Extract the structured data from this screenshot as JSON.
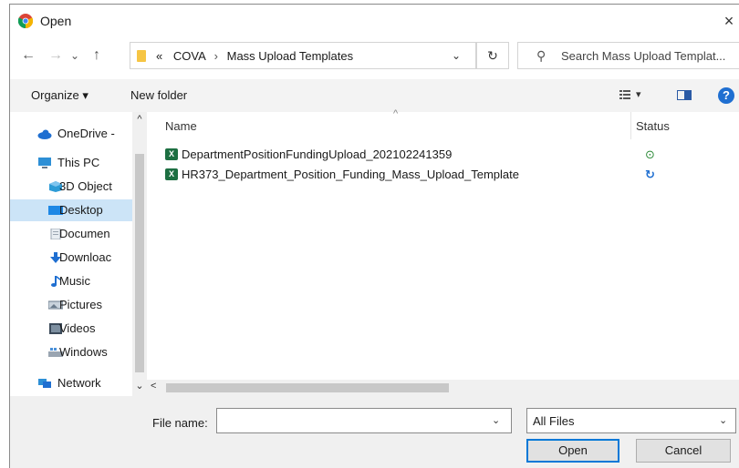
{
  "window": {
    "title": "Open",
    "close_glyph": "×"
  },
  "nav": {
    "back_glyph": "←",
    "forward_glyph": "→",
    "recent_glyph": "⌄",
    "up_glyph": "↑",
    "breadcrumb_prefix": "«",
    "breadcrumb": [
      "COVA",
      "Mass Upload Templates"
    ],
    "breadcrumb_sep": "›",
    "dropdown_glyph": "⌄",
    "refresh_glyph": "↻"
  },
  "search": {
    "placeholder": "Search Mass Upload Templat..."
  },
  "toolbar": {
    "organize_label": "Organize ▾",
    "new_folder_label": "New folder",
    "view_caret": "▾",
    "help_glyph": "?"
  },
  "sidebar": {
    "items": [
      {
        "label": "OneDrive -",
        "icon": "cloud-icon",
        "color": "#1f6fd1"
      },
      {
        "label": "This PC",
        "icon": "computer-icon",
        "color": "#2d8fd6"
      },
      {
        "label": "3D Object",
        "icon": "cube-icon",
        "color": "#2d9bd6"
      },
      {
        "label": "Desktop",
        "icon": "desktop-icon",
        "color": "#1e88e5",
        "selected": true
      },
      {
        "label": "Documen",
        "icon": "document-icon",
        "color": "#9aa5b1"
      },
      {
        "label": "Downloac",
        "icon": "download-icon",
        "color": "#1f6fd1"
      },
      {
        "label": "Music",
        "icon": "music-icon",
        "color": "#1f6fd1"
      },
      {
        "label": "Pictures",
        "icon": "pictures-icon",
        "color": "#6a7b8c"
      },
      {
        "label": "Videos",
        "icon": "videos-icon",
        "color": "#3b4a5a"
      },
      {
        "label": "Windows",
        "icon": "drive-icon",
        "color": "#4a90d9"
      },
      {
        "label": "Network",
        "icon": "network-icon",
        "color": "#2d8fd6"
      }
    ],
    "scroll_up": "^",
    "scroll_down": "⌄"
  },
  "columns": {
    "name": "Name",
    "status": "Status",
    "sort_glyph": "^"
  },
  "files": [
    {
      "name": "DepartmentPositionFundingUpload_202102241359",
      "icon": "excel-icon",
      "status_icon": "synced-check-icon",
      "status_glyph": "⊙",
      "status_color": "#2e8b3a"
    },
    {
      "name": "HR373_Department_Position_Funding_Mass_Upload_Template",
      "icon": "excel-icon",
      "status_icon": "sync-pending-icon",
      "status_glyph": "↻",
      "status_color": "#1f6fd1"
    }
  ],
  "hscroll": {
    "left_glyph": "<"
  },
  "footer": {
    "file_name_label": "File name:",
    "file_name_value": "",
    "file_name_caret": "⌄",
    "file_type": "All Files",
    "file_type_caret": "⌄",
    "open_label": "Open",
    "cancel_label": "Cancel"
  }
}
